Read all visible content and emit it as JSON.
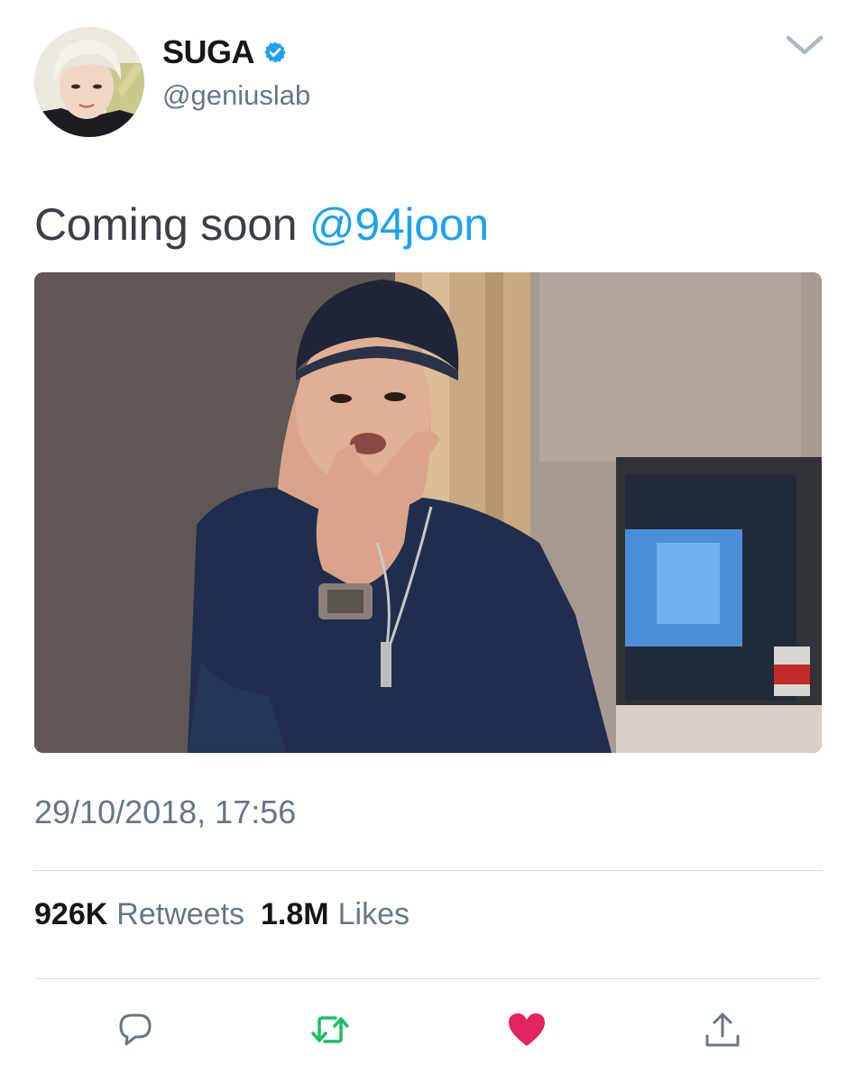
{
  "author": {
    "display_name": "SUGA",
    "handle": "@geniuslab",
    "verified_icon": "verified-badge-icon",
    "avatar": "profile-photo"
  },
  "caret_icon": "chevron-down-icon",
  "tweet": {
    "text": "Coming soon ",
    "mention": "@94joon",
    "media": "embedded-photo",
    "timestamp": "29/10/2018, 17:56"
  },
  "stats": {
    "retweets_count": "926K",
    "retweets_label": "Retweets",
    "likes_count": "1.8M",
    "likes_label": "Likes"
  },
  "actions": {
    "reply_icon": "reply-icon",
    "retweet_icon": "retweet-icon",
    "like_icon": "heart-icon",
    "share_icon": "share-icon"
  },
  "colors": {
    "link": "#1da1f2",
    "retweet": "#17bf63",
    "like": "#e0245e",
    "secondary_text": "#657786",
    "primary_text": "#14171a"
  }
}
